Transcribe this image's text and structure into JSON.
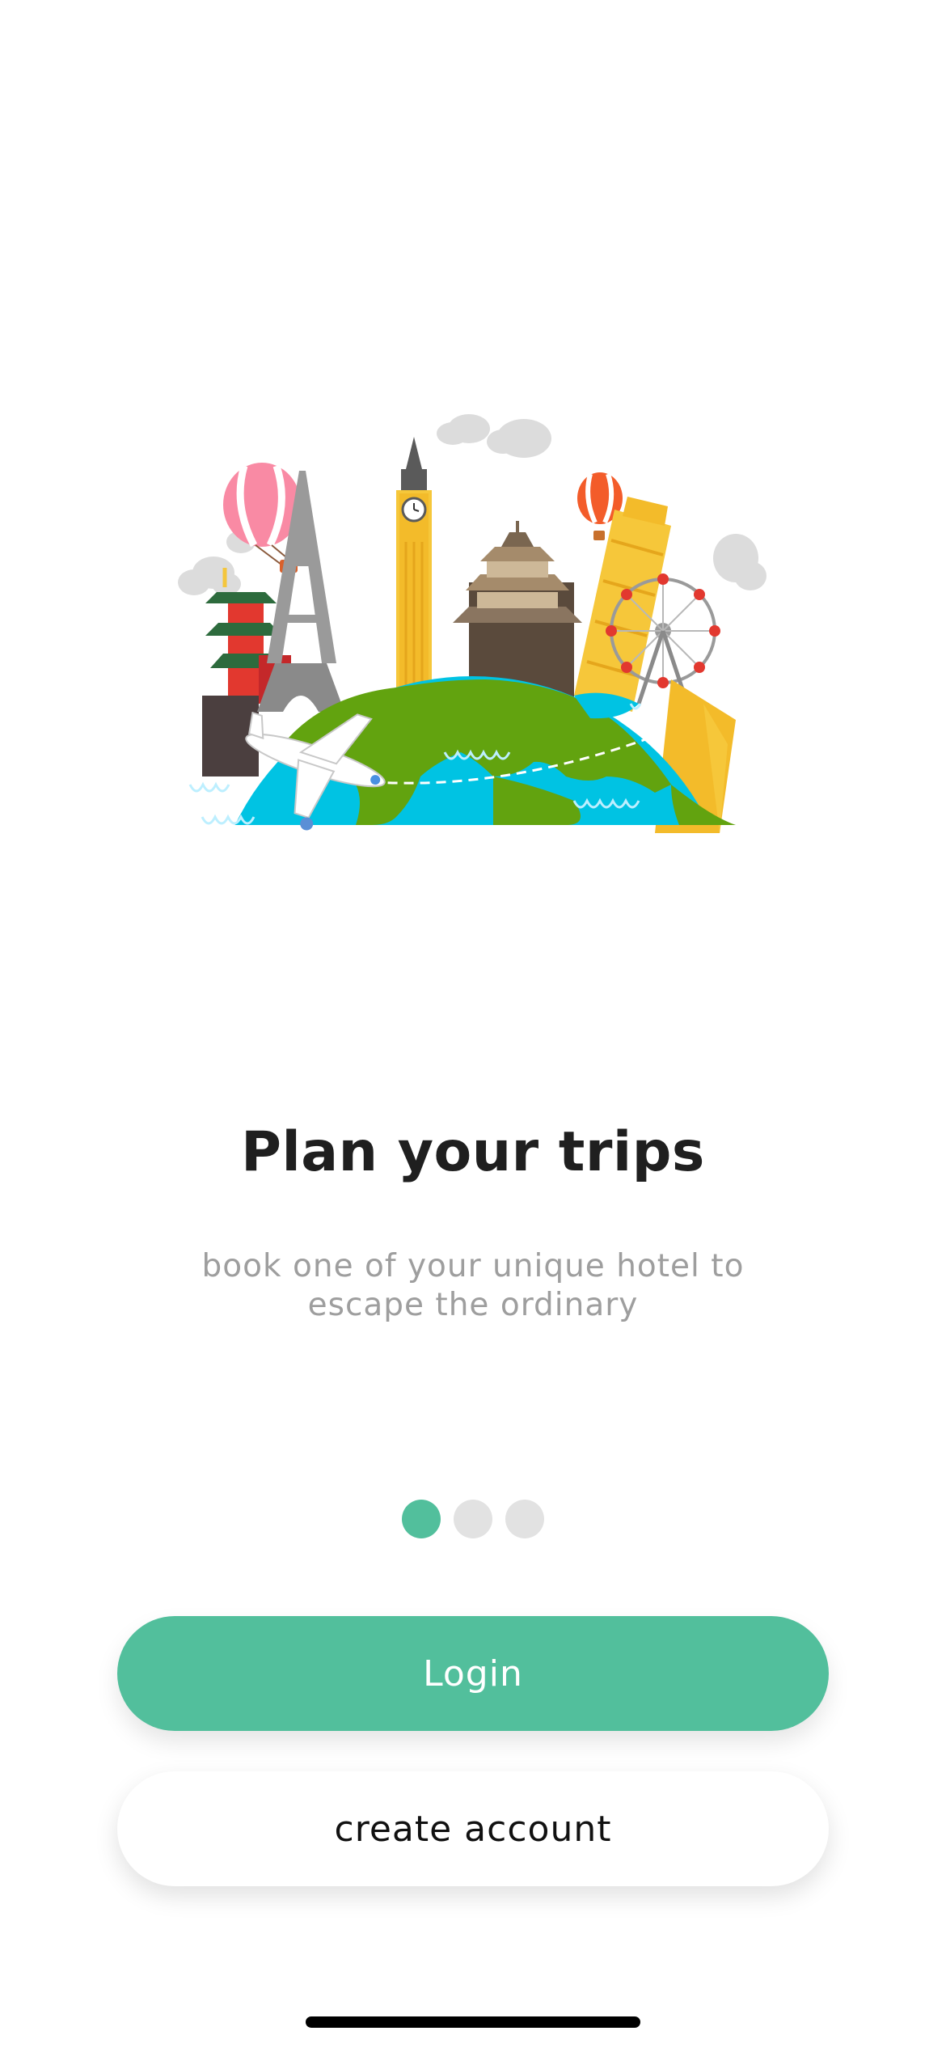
{
  "onboarding": {
    "title": "Plan your trips",
    "subtitle": "book one of your unique hotel to escape the ordinary",
    "page_indicator": {
      "total": 3,
      "active_index": 0
    }
  },
  "actions": {
    "login_label": "Login",
    "create_account_label": "create account"
  },
  "illustration": {
    "icon": "world-landmarks-illustration",
    "landmarks": [
      "eiffel-tower",
      "big-ben",
      "pagoda",
      "japanese-castle",
      "leaning-tower",
      "ferris-wheel",
      "pyramids",
      "hot-air-balloons",
      "airplane",
      "clouds"
    ]
  },
  "colors": {
    "accent": "#52bf9c",
    "dot_inactive": "#e2e2e2",
    "title": "#1f1f1f",
    "subtitle": "#9e9e9e",
    "ocean": "#00c3e3",
    "land": "#62a30f"
  }
}
